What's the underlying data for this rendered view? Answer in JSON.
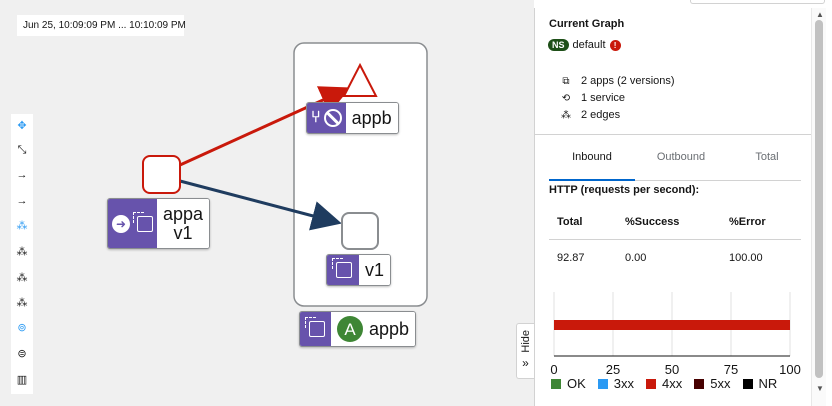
{
  "time_range": "Jun 25, 10:09:09 PM ... 10:10:09 PM",
  "toolbar": {
    "buttons": [
      {
        "name": "zoom-to-fit-button",
        "glyph": "✥"
      },
      {
        "name": "expand-button",
        "glyph": "⤡"
      },
      {
        "name": "layout-1-button",
        "glyph": "→"
      },
      {
        "name": "layout-2-button",
        "glyph": "→"
      },
      {
        "name": "layout-cose-button",
        "glyph": "⁂"
      },
      {
        "name": "layout-dagre-button",
        "glyph": "⁂"
      },
      {
        "name": "layout-grid-button",
        "glyph": "⁂"
      },
      {
        "name": "layout-concentric-button",
        "glyph": "⁂"
      },
      {
        "name": "namespace-box-button",
        "glyph": "⊚"
      },
      {
        "name": "legend-toggle-button",
        "glyph": "⊜"
      },
      {
        "name": "map-button",
        "glyph": "▥"
      }
    ]
  },
  "graph": {
    "nodes": {
      "appa": {
        "label_line1": "appa",
        "label_line2": "v1"
      },
      "appb_service": {
        "label": "appb"
      },
      "v1_workload": {
        "label": "v1"
      },
      "appb_app": {
        "label": "appb",
        "badge_letter": "A"
      }
    },
    "colors": {
      "error_edge": "#c9190b",
      "ok_edge": "#1f3c5f",
      "badge": "#6753ac",
      "app_badge": "#3e8635"
    }
  },
  "hide_tab": {
    "label": "Hide",
    "icon": "»"
  },
  "side_panel": {
    "title": "Current Graph",
    "namespace_badge": "NS",
    "namespace": "default",
    "namespace_error_icon": "!",
    "summary": [
      {
        "icon": "apps-icon",
        "glyph": "⧉",
        "text": "2 apps (2 versions)"
      },
      {
        "icon": "service-icon",
        "glyph": "⟲",
        "text": "1 service"
      },
      {
        "icon": "edges-icon",
        "glyph": "⁂",
        "text": "2 edges"
      }
    ],
    "tabs": [
      {
        "label": "Inbound",
        "active": true
      },
      {
        "label": "Outbound",
        "active": false
      },
      {
        "label": "Total",
        "active": false
      }
    ],
    "http_heading": "HTTP (requests per second):",
    "table": {
      "headers": [
        "Total",
        "%Success",
        "%Error"
      ],
      "row": [
        "92.87",
        "0.00",
        "100.00"
      ]
    }
  },
  "chart_data": {
    "type": "bar",
    "orientation": "horizontal",
    "categories": [
      ""
    ],
    "series": [
      {
        "name": "OK",
        "color": "#3e8635",
        "values": [
          0
        ]
      },
      {
        "name": "3xx",
        "color": "#2b9af3",
        "values": [
          0
        ]
      },
      {
        "name": "4xx",
        "color": "#c9190b",
        "values": [
          100
        ]
      },
      {
        "name": "5xx",
        "color": "#470000",
        "values": [
          0
        ]
      },
      {
        "name": "NR",
        "color": "#000000",
        "values": [
          0
        ]
      }
    ],
    "stacked": true,
    "xlim": [
      0,
      100
    ],
    "xticks": [
      "0",
      "25",
      "50",
      "75",
      "100"
    ],
    "grid": true,
    "legend": "bottom"
  }
}
